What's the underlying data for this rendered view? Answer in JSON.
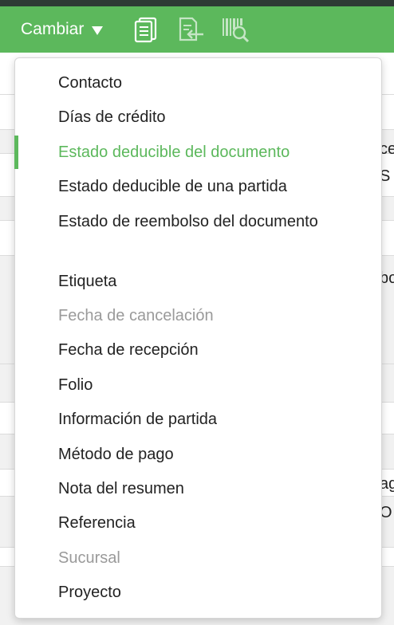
{
  "toolbar": {
    "change_label": "Cambiar",
    "icons": [
      "documents-icon",
      "document-import-icon",
      "barcode-search-icon"
    ]
  },
  "background": {
    "peek": [
      "ce",
      "S",
      "bo",
      "ag",
      "O"
    ]
  },
  "menu": {
    "items": [
      {
        "label": "Contacto",
        "state": "normal"
      },
      {
        "label": "Días de crédito",
        "state": "normal"
      },
      {
        "label": "Estado deducible del documento",
        "state": "active"
      },
      {
        "label": "Estado deducible de una partida",
        "state": "normal"
      },
      {
        "label": "Estado de reembolso del documento",
        "state": "normal"
      },
      {
        "label": "Etiqueta",
        "state": "normal"
      },
      {
        "label": "Fecha de cancelación",
        "state": "disabled"
      },
      {
        "label": "Fecha de recepción",
        "state": "normal"
      },
      {
        "label": "Folio",
        "state": "normal"
      },
      {
        "label": "Información de partida",
        "state": "normal"
      },
      {
        "label": "Método de pago",
        "state": "normal"
      },
      {
        "label": "Nota del resumen",
        "state": "normal"
      },
      {
        "label": "Referencia",
        "state": "normal"
      },
      {
        "label": "Sucursal",
        "state": "disabled"
      },
      {
        "label": "Proyecto",
        "state": "normal"
      }
    ]
  },
  "colors": {
    "accent": "#5cb85c",
    "disabled_text": "#9a9a9a",
    "text": "#222222"
  }
}
